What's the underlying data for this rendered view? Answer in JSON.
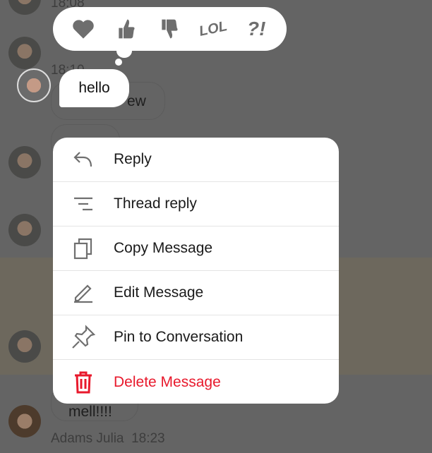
{
  "background": {
    "times": [
      "18:08",
      "18:10"
    ],
    "bubbles": [
      "ew",
      "mell!!!!"
    ],
    "last_sender": "Adams Julia",
    "last_time": "18:23"
  },
  "reactions": [
    {
      "icon": "heart-icon"
    },
    {
      "icon": "thumbs-up-icon"
    },
    {
      "icon": "thumbs-down-icon"
    },
    {
      "icon": "lol-icon",
      "label": "LOL"
    },
    {
      "icon": "exclamation-question-icon",
      "label": "?!"
    }
  ],
  "selected_message": {
    "text": "hello"
  },
  "menu": {
    "items": [
      {
        "label": "Reply",
        "icon": "reply-icon"
      },
      {
        "label": "Thread reply",
        "icon": "thread-icon"
      },
      {
        "label": "Copy Message",
        "icon": "copy-icon"
      },
      {
        "label": "Edit Message",
        "icon": "pencil-icon"
      },
      {
        "label": "Pin to Conversation",
        "icon": "pin-icon"
      },
      {
        "label": "Delete Message",
        "icon": "trash-icon",
        "color": "#e8192c"
      }
    ]
  }
}
